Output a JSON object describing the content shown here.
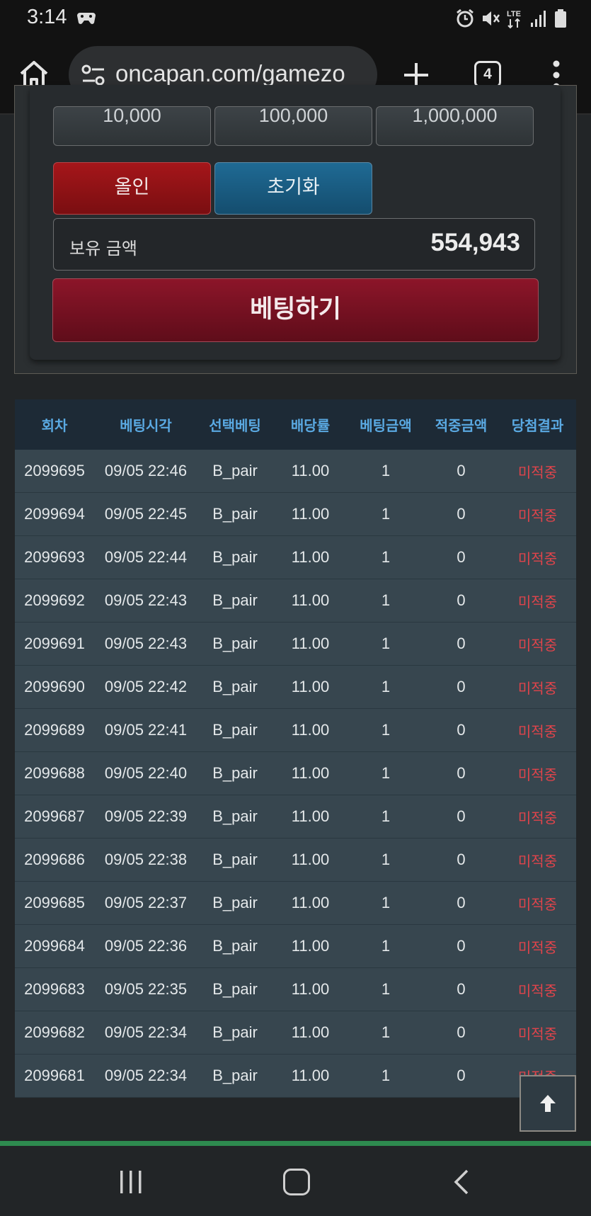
{
  "status_bar": {
    "time": "3:14",
    "icons": [
      "game-controller-icon",
      "alarm-icon",
      "mute-icon",
      "lte-icon",
      "signal-icon",
      "battery-icon"
    ],
    "network": "LTE"
  },
  "browser": {
    "url": "oncapan.com/gamezo",
    "tab_count": "4",
    "icons": [
      "home-icon",
      "site-settings-icon",
      "new-tab-plus-icon",
      "more-vert-icon"
    ]
  },
  "bet_panel": {
    "chips": [
      "10,000",
      "100,000",
      "1,000,000"
    ],
    "allin_label": "올인",
    "reset_label": "초기화",
    "balance_label": "보유 금액",
    "balance_value": "554,943",
    "bet_button_label": "베팅하기",
    "colors": {
      "allin": "#a5161a",
      "reset": "#1f6a94",
      "bet": "#8c1529"
    }
  },
  "history": {
    "headers": [
      "회차",
      "베팅시각",
      "선택베팅",
      "배당률",
      "베팅금액",
      "적중금액",
      "당첨결과"
    ],
    "rows": [
      [
        "2099695",
        "09/05 22:46",
        "B_pair",
        "11.00",
        "1",
        "0",
        "미적중"
      ],
      [
        "2099694",
        "09/05 22:45",
        "B_pair",
        "11.00",
        "1",
        "0",
        "미적중"
      ],
      [
        "2099693",
        "09/05 22:44",
        "B_pair",
        "11.00",
        "1",
        "0",
        "미적중"
      ],
      [
        "2099692",
        "09/05 22:43",
        "B_pair",
        "11.00",
        "1",
        "0",
        "미적중"
      ],
      [
        "2099691",
        "09/05 22:43",
        "B_pair",
        "11.00",
        "1",
        "0",
        "미적중"
      ],
      [
        "2099690",
        "09/05 22:42",
        "B_pair",
        "11.00",
        "1",
        "0",
        "미적중"
      ],
      [
        "2099689",
        "09/05 22:41",
        "B_pair",
        "11.00",
        "1",
        "0",
        "미적중"
      ],
      [
        "2099688",
        "09/05 22:40",
        "B_pair",
        "11.00",
        "1",
        "0",
        "미적중"
      ],
      [
        "2099687",
        "09/05 22:39",
        "B_pair",
        "11.00",
        "1",
        "0",
        "미적중"
      ],
      [
        "2099686",
        "09/05 22:38",
        "B_pair",
        "11.00",
        "1",
        "0",
        "미적중"
      ],
      [
        "2099685",
        "09/05 22:37",
        "B_pair",
        "11.00",
        "1",
        "0",
        "미적중"
      ],
      [
        "2099684",
        "09/05 22:36",
        "B_pair",
        "11.00",
        "1",
        "0",
        "미적중"
      ],
      [
        "2099683",
        "09/05 22:35",
        "B_pair",
        "11.00",
        "1",
        "0",
        "미적중"
      ],
      [
        "2099682",
        "09/05 22:34",
        "B_pair",
        "11.00",
        "1",
        "0",
        "미적중"
      ],
      [
        "2099681",
        "09/05 22:34",
        "B_pair",
        "11.00",
        "1",
        "0",
        "미적중"
      ]
    ],
    "colors": {
      "header_text": "#5aa9e2",
      "result_text": "#e0444b"
    }
  },
  "floating": {
    "scroll_top_icon": "arrow-up-icon"
  },
  "nav_bar": {
    "icons": [
      "recent-apps-icon",
      "home-nav-icon",
      "back-icon"
    ]
  }
}
